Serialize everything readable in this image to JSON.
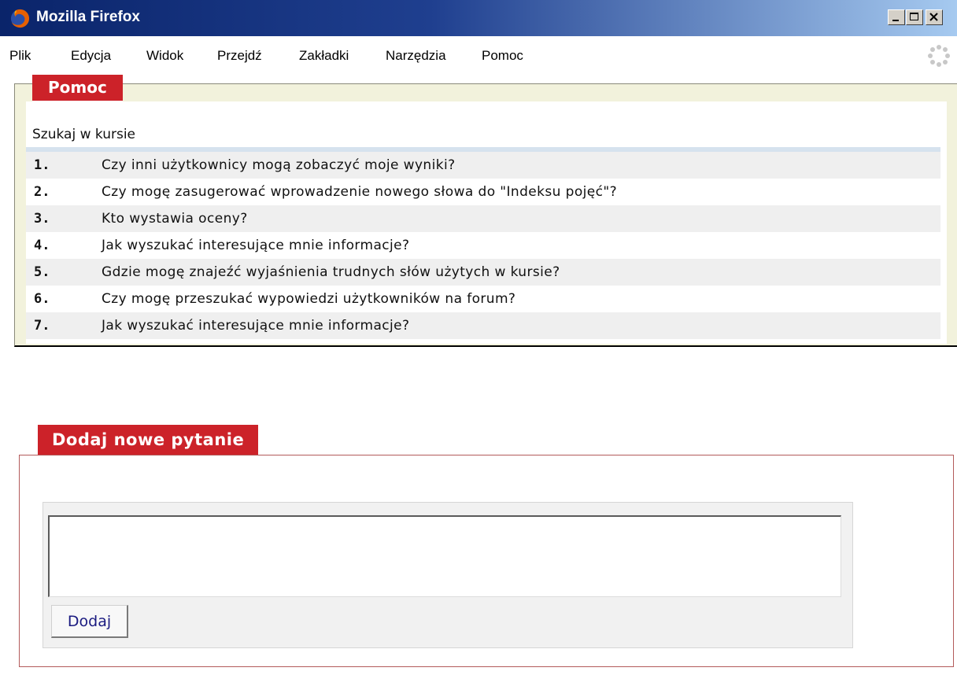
{
  "window": {
    "title": "Mozilla Firefox",
    "titlebar_color": "#0a246a"
  },
  "menu": {
    "items": [
      "Plik",
      "Edycja",
      "Widok",
      "Przejdź",
      "Zakładki",
      "Narzędzia",
      "Pomoc"
    ]
  },
  "help_panel": {
    "legend": "Pomoc",
    "search_label": "Szukaj w kursie",
    "questions": [
      {
        "num": "1.",
        "text": "Czy inni użytkownicy mogą zobaczyć moje wyniki?"
      },
      {
        "num": "2.",
        "text": "Czy mogę zasugerować wprowadzenie nowego słowa do \"Indeksu pojęć\"?"
      },
      {
        "num": "3.",
        "text": "Kto wystawia oceny?"
      },
      {
        "num": "4.",
        "text": "Jak wyszukać interesujące mnie informacje?"
      },
      {
        "num": "5.",
        "text": "Gdzie mogę znajeźć wyjaśnienia trudnych słów użytych w kursie?"
      },
      {
        "num": "6.",
        "text": "Czy mogę przeszukać wypowiedzi użytkowników na forum?"
      },
      {
        "num": "7.",
        "text": "Jak wyszukać interesujące mnie informacje?"
      }
    ]
  },
  "add_question": {
    "legend": "Dodaj nowe pytanie",
    "input_value": "",
    "button_label": "Dodaj",
    "accent_color": "#cc2229"
  }
}
